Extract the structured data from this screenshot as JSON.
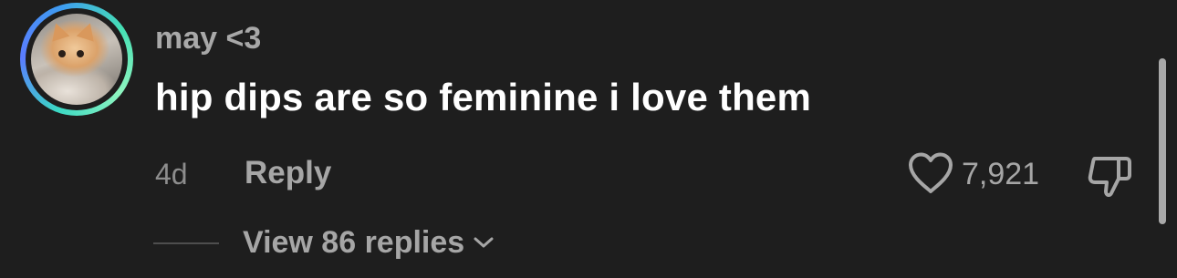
{
  "comment": {
    "username": "may <3",
    "text": "hip dips are so feminine i love them",
    "age": "4d",
    "reply_label": "Reply",
    "like_count": "7,921",
    "view_replies_label": "View 86 replies",
    "avatar_icon": "kitten-avatar",
    "like_icon": "heart-outline-icon",
    "dislike_icon": "thumbs-down-outline-icon",
    "expand_icon": "chevron-down-icon"
  },
  "colors": {
    "background": "#1e1e1e",
    "username": "#a8a8a8",
    "body_text": "#ffffff",
    "secondary_text": "#a6a6a6",
    "ring_gradient": [
      "#3bd9c4",
      "#5b7cff",
      "#8ff5c0"
    ]
  }
}
